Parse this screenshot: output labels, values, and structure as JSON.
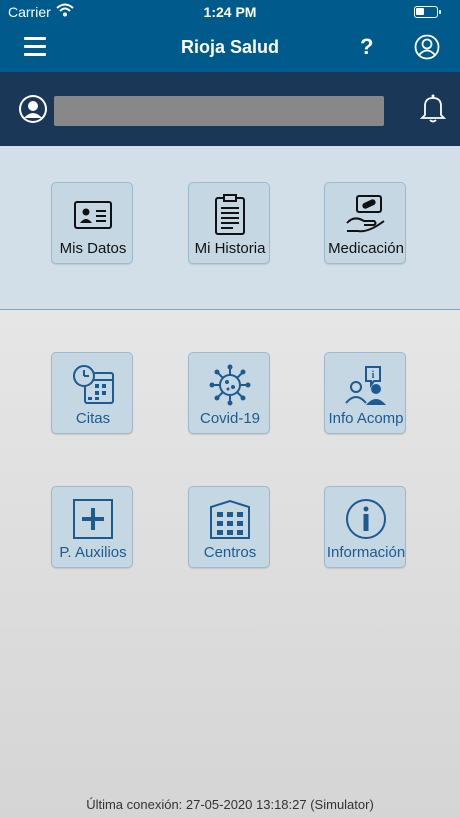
{
  "status": {
    "carrier": "Carrier",
    "time": "1:24 PM"
  },
  "nav": {
    "title": "Rioja Salud",
    "help": "?"
  },
  "tiles_top": [
    {
      "label": "Mis Datos",
      "icon": "id-card-icon"
    },
    {
      "label": "Mi Historia",
      "icon": "clipboard-icon"
    },
    {
      "label": "Medicación",
      "icon": "medication-hand-icon"
    }
  ],
  "tiles_bottom": [
    {
      "label": "Citas",
      "icon": "calendar-clock-icon"
    },
    {
      "label": "Covid-19",
      "icon": "virus-icon"
    },
    {
      "label": "Info Acomp",
      "icon": "companions-info-icon"
    },
    {
      "label": "P. Auxilios",
      "icon": "first-aid-icon"
    },
    {
      "label": "Centros",
      "icon": "building-icon"
    },
    {
      "label": "Información",
      "icon": "info-icon"
    }
  ],
  "footer": {
    "text": "Última conexión: 27-05-2020 13:18:27 (Simulator)"
  },
  "colors": {
    "primary": "#005a8c",
    "header_dark": "#1b3758",
    "tile_bg": "#c5d7e3",
    "label_blue": "#1c5a92"
  }
}
